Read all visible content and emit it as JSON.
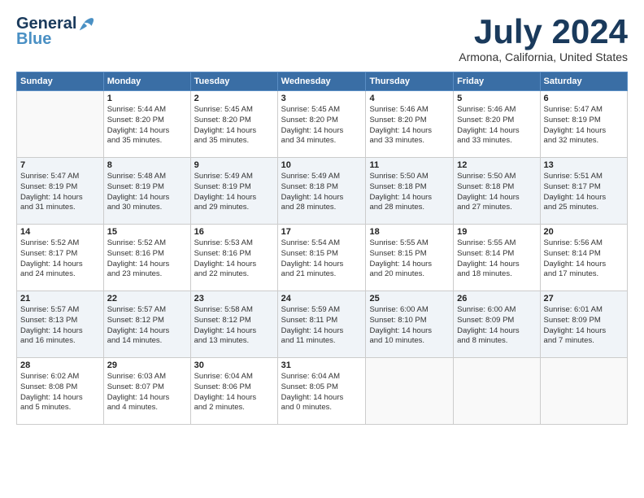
{
  "header": {
    "logo_general": "General",
    "logo_blue": "Blue",
    "title": "July 2024",
    "location": "Armona, California, United States"
  },
  "days_of_week": [
    "Sunday",
    "Monday",
    "Tuesday",
    "Wednesday",
    "Thursday",
    "Friday",
    "Saturday"
  ],
  "weeks": [
    [
      {
        "num": "",
        "info": ""
      },
      {
        "num": "1",
        "info": "Sunrise: 5:44 AM\nSunset: 8:20 PM\nDaylight: 14 hours\nand 35 minutes."
      },
      {
        "num": "2",
        "info": "Sunrise: 5:45 AM\nSunset: 8:20 PM\nDaylight: 14 hours\nand 35 minutes."
      },
      {
        "num": "3",
        "info": "Sunrise: 5:45 AM\nSunset: 8:20 PM\nDaylight: 14 hours\nand 34 minutes."
      },
      {
        "num": "4",
        "info": "Sunrise: 5:46 AM\nSunset: 8:20 PM\nDaylight: 14 hours\nand 33 minutes."
      },
      {
        "num": "5",
        "info": "Sunrise: 5:46 AM\nSunset: 8:20 PM\nDaylight: 14 hours\nand 33 minutes."
      },
      {
        "num": "6",
        "info": "Sunrise: 5:47 AM\nSunset: 8:19 PM\nDaylight: 14 hours\nand 32 minutes."
      }
    ],
    [
      {
        "num": "7",
        "info": "Sunrise: 5:47 AM\nSunset: 8:19 PM\nDaylight: 14 hours\nand 31 minutes."
      },
      {
        "num": "8",
        "info": "Sunrise: 5:48 AM\nSunset: 8:19 PM\nDaylight: 14 hours\nand 30 minutes."
      },
      {
        "num": "9",
        "info": "Sunrise: 5:49 AM\nSunset: 8:19 PM\nDaylight: 14 hours\nand 29 minutes."
      },
      {
        "num": "10",
        "info": "Sunrise: 5:49 AM\nSunset: 8:18 PM\nDaylight: 14 hours\nand 28 minutes."
      },
      {
        "num": "11",
        "info": "Sunrise: 5:50 AM\nSunset: 8:18 PM\nDaylight: 14 hours\nand 28 minutes."
      },
      {
        "num": "12",
        "info": "Sunrise: 5:50 AM\nSunset: 8:18 PM\nDaylight: 14 hours\nand 27 minutes."
      },
      {
        "num": "13",
        "info": "Sunrise: 5:51 AM\nSunset: 8:17 PM\nDaylight: 14 hours\nand 25 minutes."
      }
    ],
    [
      {
        "num": "14",
        "info": "Sunrise: 5:52 AM\nSunset: 8:17 PM\nDaylight: 14 hours\nand 24 minutes."
      },
      {
        "num": "15",
        "info": "Sunrise: 5:52 AM\nSunset: 8:16 PM\nDaylight: 14 hours\nand 23 minutes."
      },
      {
        "num": "16",
        "info": "Sunrise: 5:53 AM\nSunset: 8:16 PM\nDaylight: 14 hours\nand 22 minutes."
      },
      {
        "num": "17",
        "info": "Sunrise: 5:54 AM\nSunset: 8:15 PM\nDaylight: 14 hours\nand 21 minutes."
      },
      {
        "num": "18",
        "info": "Sunrise: 5:55 AM\nSunset: 8:15 PM\nDaylight: 14 hours\nand 20 minutes."
      },
      {
        "num": "19",
        "info": "Sunrise: 5:55 AM\nSunset: 8:14 PM\nDaylight: 14 hours\nand 18 minutes."
      },
      {
        "num": "20",
        "info": "Sunrise: 5:56 AM\nSunset: 8:14 PM\nDaylight: 14 hours\nand 17 minutes."
      }
    ],
    [
      {
        "num": "21",
        "info": "Sunrise: 5:57 AM\nSunset: 8:13 PM\nDaylight: 14 hours\nand 16 minutes."
      },
      {
        "num": "22",
        "info": "Sunrise: 5:57 AM\nSunset: 8:12 PM\nDaylight: 14 hours\nand 14 minutes."
      },
      {
        "num": "23",
        "info": "Sunrise: 5:58 AM\nSunset: 8:12 PM\nDaylight: 14 hours\nand 13 minutes."
      },
      {
        "num": "24",
        "info": "Sunrise: 5:59 AM\nSunset: 8:11 PM\nDaylight: 14 hours\nand 11 minutes."
      },
      {
        "num": "25",
        "info": "Sunrise: 6:00 AM\nSunset: 8:10 PM\nDaylight: 14 hours\nand 10 minutes."
      },
      {
        "num": "26",
        "info": "Sunrise: 6:00 AM\nSunset: 8:09 PM\nDaylight: 14 hours\nand 8 minutes."
      },
      {
        "num": "27",
        "info": "Sunrise: 6:01 AM\nSunset: 8:09 PM\nDaylight: 14 hours\nand 7 minutes."
      }
    ],
    [
      {
        "num": "28",
        "info": "Sunrise: 6:02 AM\nSunset: 8:08 PM\nDaylight: 14 hours\nand 5 minutes."
      },
      {
        "num": "29",
        "info": "Sunrise: 6:03 AM\nSunset: 8:07 PM\nDaylight: 14 hours\nand 4 minutes."
      },
      {
        "num": "30",
        "info": "Sunrise: 6:04 AM\nSunset: 8:06 PM\nDaylight: 14 hours\nand 2 minutes."
      },
      {
        "num": "31",
        "info": "Sunrise: 6:04 AM\nSunset: 8:05 PM\nDaylight: 14 hours\nand 0 minutes."
      },
      {
        "num": "",
        "info": ""
      },
      {
        "num": "",
        "info": ""
      },
      {
        "num": "",
        "info": ""
      }
    ]
  ]
}
